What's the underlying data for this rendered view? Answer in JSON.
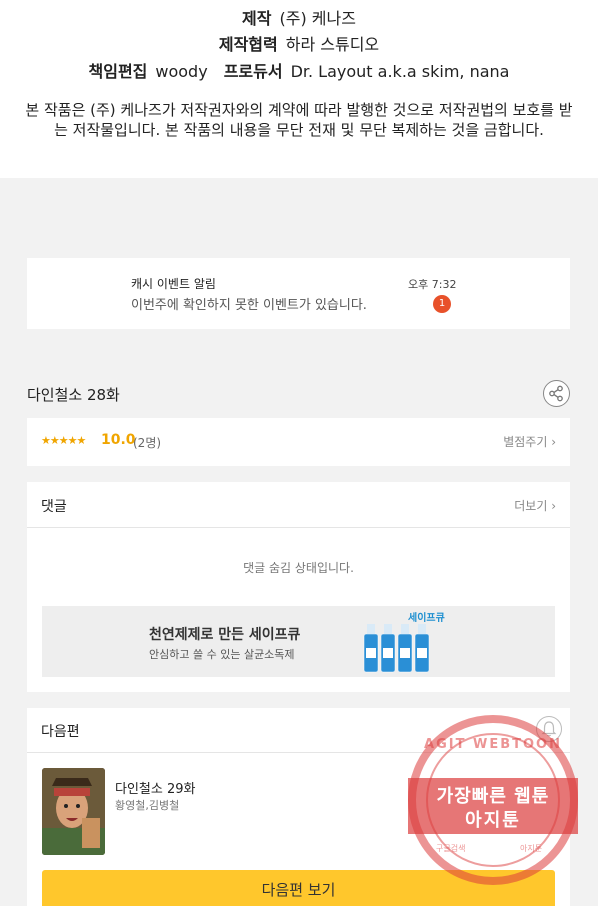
{
  "credits": {
    "production_label": "제작",
    "production_value": "(주) 케나즈",
    "cooperation_label": "제작협력",
    "cooperation_value": "하라 스튜디오",
    "editor_label": "책임편집",
    "editor_value": "woody",
    "producer_label": "프로듀서",
    "producer_value": "Dr. Layout a.k.a skim, nana",
    "copyright": "본 작품은 (주) 케나즈가 저작권자와의 계약에 따라 발행한 것으로 저작권법의 보호를 받는 저작물입니다. 본 작품의 내용을 무단 전재 및 무단 복제하는 것을 금합니다."
  },
  "notification": {
    "title": "캐시 이벤트 알림",
    "message": "이번주에 확인하지 못한 이벤트가 있습니다.",
    "time": "오후 7:32",
    "badge": "1"
  },
  "episode": {
    "title": "다인철소 28화",
    "stars": "★★★★★",
    "score": "10.0",
    "count": "(2명)",
    "rate_label": "별점주기 ›"
  },
  "comments": {
    "heading": "댓글",
    "more_label": "더보기 ›",
    "hidden_message": "댓글 숨김 상태입니다."
  },
  "ad": {
    "title": "천연제제로 만든 세이프큐",
    "subtitle": "안심하고 쓸 수 있는 살균소독제",
    "brand": "세이프큐"
  },
  "next_episode": {
    "heading": "다음편",
    "title": "다인철소 29화",
    "authors": "황영철,김병철",
    "button_label": "다음편 보기"
  },
  "watermark": {
    "top_text": "AGIT WEBTOON",
    "line1": "가장빠른 웹툰",
    "line2": "아지툰",
    "bottom_left": "구글검색",
    "bottom_right": "아지툰"
  },
  "colors": {
    "accent_yellow": "#ffc72c",
    "star_orange": "#f0a500",
    "badge_red": "#e8512a",
    "watermark_red": "#dc3c3c"
  }
}
